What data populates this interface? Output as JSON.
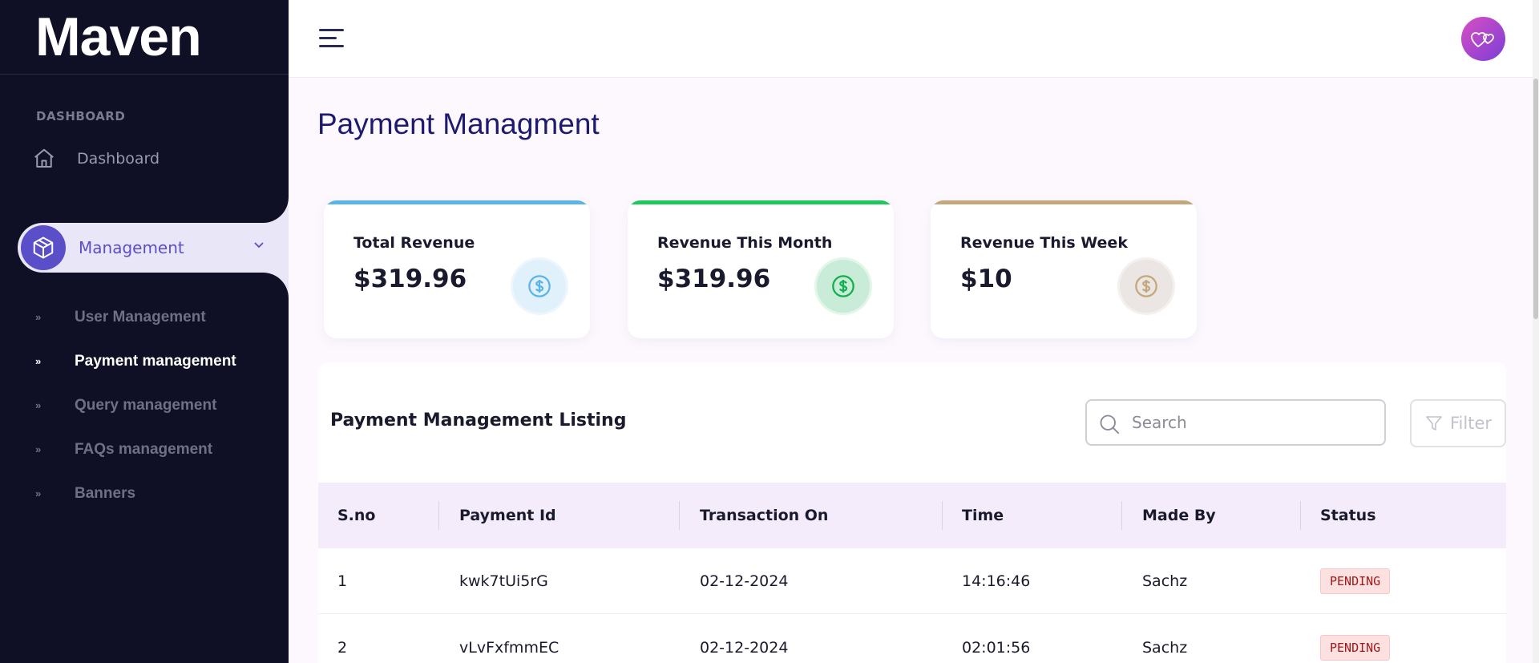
{
  "sidebar": {
    "logo": "Maven",
    "section_label": "DASHBOARD",
    "dashboard_label": "Dashboard",
    "management_label": "Management",
    "items": [
      {
        "label": "User Management",
        "active": false
      },
      {
        "label": "Payment management",
        "active": true
      },
      {
        "label": "Query management",
        "active": false
      },
      {
        "label": "FAQs management",
        "active": false
      },
      {
        "label": "Banners",
        "active": false
      }
    ]
  },
  "header": {
    "menu_icon": "hamburger-icon",
    "avatar_icon": "hearts-icon"
  },
  "page": {
    "title": "Payment Managment"
  },
  "cards": [
    {
      "label": "Total Revenue",
      "value": "$319.96",
      "accent": "#5ab4e8",
      "icon": "dollar-circle-icon"
    },
    {
      "label": "Revenue This Month",
      "value": "$319.96",
      "accent": "#1dc95a",
      "icon": "dollar-circle-icon"
    },
    {
      "label": "Revenue This Week",
      "value": "$10",
      "accent": "#c4a77a",
      "icon": "dollar-circle-icon"
    }
  ],
  "listing": {
    "title": "Payment Management Listing",
    "search_placeholder": "Search",
    "filter_label": "Filter",
    "columns": [
      "S.no",
      "Payment Id",
      "Transaction On",
      "Time",
      "Made By",
      "Status"
    ],
    "rows": [
      {
        "sno": "1",
        "payment_id": "kwk7tUi5rG",
        "transaction_on": "02-12-2024",
        "time": "14:16:46",
        "made_by": "Sachz",
        "status": "PENDING"
      },
      {
        "sno": "2",
        "payment_id": "vLvFxfmmEC",
        "transaction_on": "02-12-2024",
        "time": "02:01:56",
        "made_by": "Sachz",
        "status": "PENDING"
      }
    ]
  },
  "colors": {
    "sidebar_bg": "#0f0f26",
    "accent": "#5a4fc8",
    "title": "#1d1a70",
    "table_header_bg": "#f5ecfb",
    "status_pending_bg": "#fde1e1",
    "status_pending_text": "#a01919"
  }
}
